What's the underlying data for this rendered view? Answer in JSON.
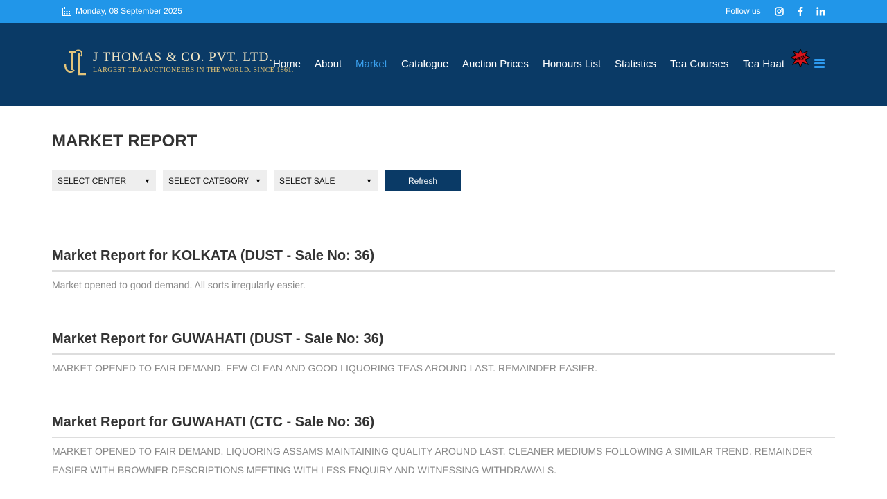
{
  "topbar": {
    "date": "Monday, 08 September 2025",
    "follow_label": "Follow us",
    "social_icons": [
      "instagram-icon",
      "facebook-icon",
      "linkedin-icon"
    ],
    "bg_color": "#2196e9"
  },
  "header": {
    "logo_name": "J THOMAS & CO. PVT. LTD.",
    "logo_tagline": "LARGEST TEA AUCTIONEERS IN THE WORLD. SINCE 1861.",
    "bg_color": "#0a3a66"
  },
  "nav": {
    "items": [
      {
        "label": "Home",
        "active": false
      },
      {
        "label": "About",
        "active": false
      },
      {
        "label": "Market",
        "active": true
      },
      {
        "label": "Catalogue",
        "active": false
      },
      {
        "label": "Auction Prices",
        "active": false
      },
      {
        "label": "Honours List",
        "active": false
      },
      {
        "label": "Statistics",
        "active": false
      },
      {
        "label": "Tea Courses",
        "active": false
      },
      {
        "label": "Tea Haat",
        "active": false
      }
    ],
    "new_badge": "NEW",
    "active_color": "#3aa0ee"
  },
  "page": {
    "title": "MARKET REPORT"
  },
  "filters": {
    "center": "SELECT CENTER",
    "category": "SELECT CATEGORY",
    "sale": "SELECT SALE",
    "refresh_label": "Refresh"
  },
  "reports": [
    {
      "heading": "Market Report for KOLKATA (DUST - Sale No: 36)",
      "body": "Market opened to good demand. All sorts irregularly easier."
    },
    {
      "heading": "Market Report for GUWAHATI (DUST - Sale No: 36)",
      "body": "MARKET OPENED TO FAIR DEMAND. FEW CLEAN AND GOOD LIQUORING TEAS AROUND LAST. REMAINDER EASIER."
    },
    {
      "heading": "Market Report for GUWAHATI (CTC - Sale No: 36)",
      "body": "MARKET OPENED TO FAIR DEMAND. LIQUORING ASSAMS MAINTAINING QUALITY AROUND LAST. CLEANER MEDIUMS FOLLOWING A SIMILAR TREND. REMAINDER EASIER WITH BROWNER DESCRIPTIONS MEETING WITH LESS ENQUIRY AND WITNESSING WITHDRAWALS."
    }
  ]
}
